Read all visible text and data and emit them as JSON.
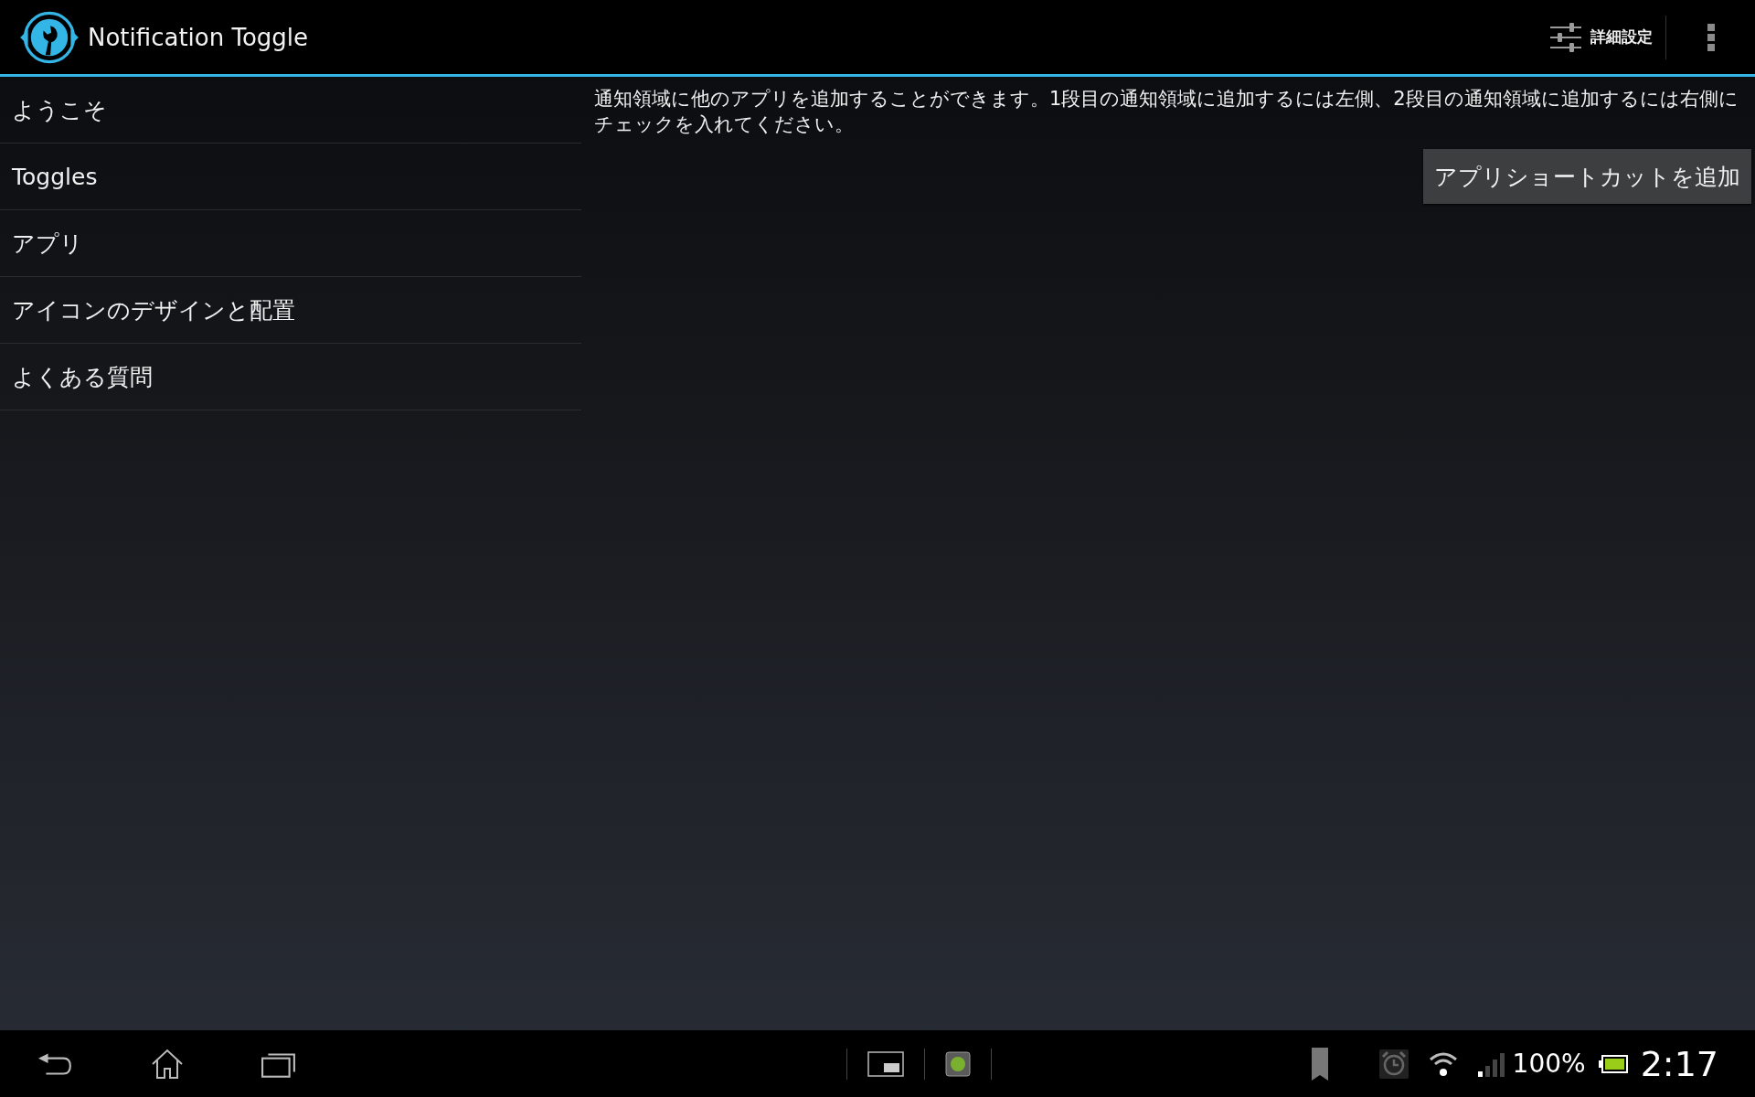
{
  "action_bar": {
    "title": "Notification Toggle",
    "settings_label": "詳細設定"
  },
  "sidebar": {
    "items": [
      {
        "label": "ようこそ"
      },
      {
        "label": "Toggles"
      },
      {
        "label": "アプリ"
      },
      {
        "label": "アイコンのデザインと配置"
      },
      {
        "label": "よくある質問"
      }
    ]
  },
  "content": {
    "description": "通知領域に他のアプリを追加することができます。1段目の通知領域に追加するには左側、2段目の通知領域に追加するには右側にチェックを入れてください。",
    "button": "アプリショートカットを追加"
  },
  "status_bar": {
    "battery": "100%",
    "time": "2:17"
  }
}
